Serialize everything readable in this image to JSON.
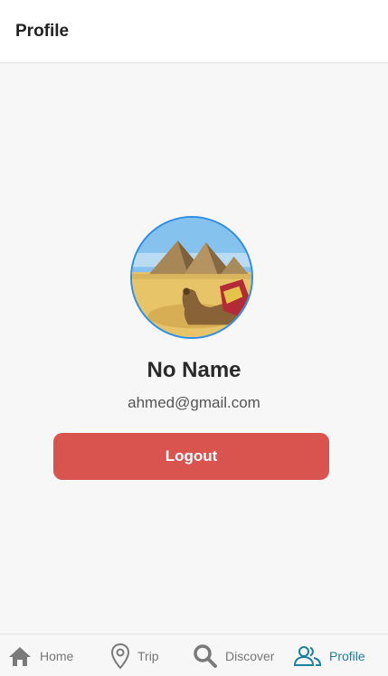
{
  "header": {
    "title": "Profile"
  },
  "profile": {
    "name": "No Name",
    "email": "ahmed@gmail.com",
    "avatar_icon": "pyramids-camel-photo",
    "logout_label": "Logout"
  },
  "colors": {
    "logout": "#d9534f",
    "active_tab": "#1a7fa0",
    "avatar_ring": "#2e8ee6",
    "inactive_tab": "#777777"
  },
  "nav": {
    "items": [
      {
        "label": "Home",
        "icon": "home-icon",
        "active": false
      },
      {
        "label": "Trip",
        "icon": "map-pin-icon",
        "active": false
      },
      {
        "label": "Discover",
        "icon": "search-icon",
        "active": false
      },
      {
        "label": "Profile",
        "icon": "users-icon",
        "active": true
      }
    ]
  }
}
